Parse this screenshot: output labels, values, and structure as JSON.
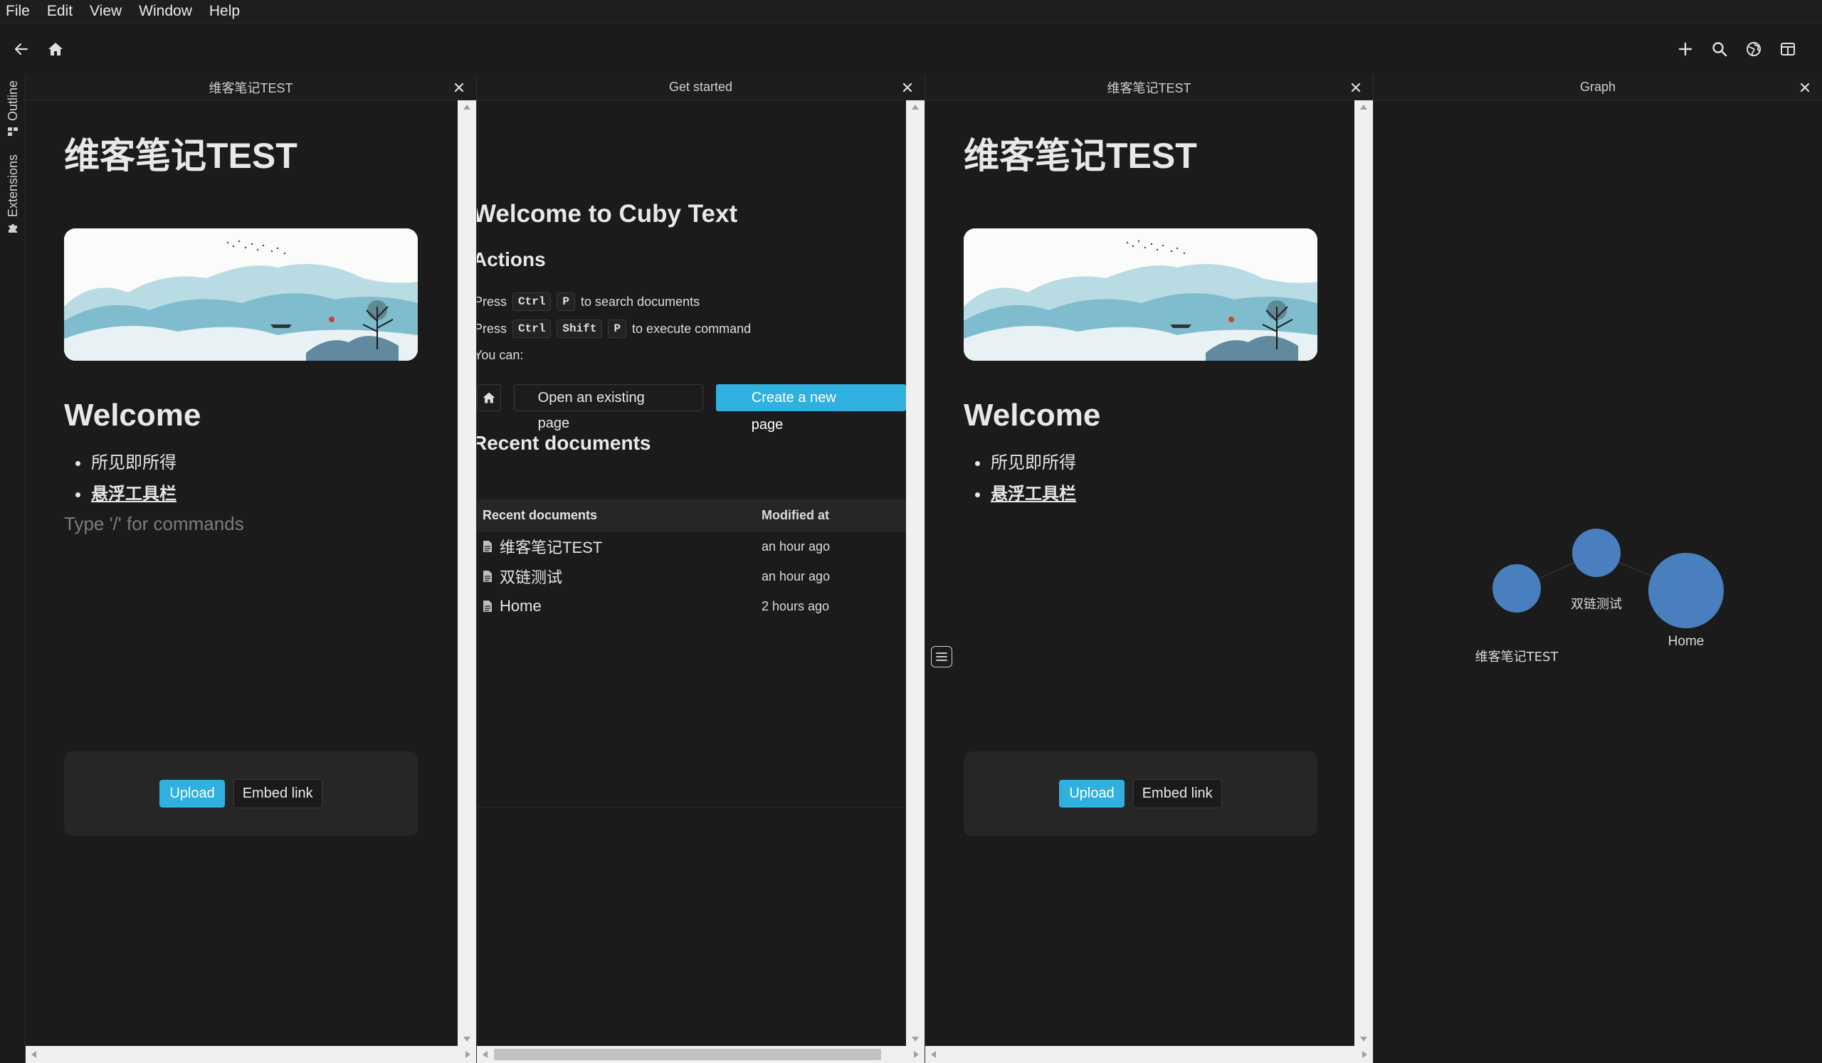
{
  "menu": [
    "File",
    "Edit",
    "View",
    "Window",
    "Help"
  ],
  "toolbar": {
    "left_icons": [
      "back-arrow-icon",
      "home-icon"
    ],
    "right_icons": [
      "plus-icon",
      "search-icon",
      "globe-icon",
      "split-view-icon"
    ]
  },
  "rail": {
    "outline": "Outline",
    "extensions": "Extensions"
  },
  "panes": {
    "left": {
      "tab": "维客笔记TEST",
      "title": "维客笔记TEST",
      "heading": "Welcome",
      "bullets": [
        "所见即所得",
        "悬浮工具栏"
      ],
      "placeholder": "Type '/' for commands",
      "upload": "Upload",
      "embed": "Embed link"
    },
    "middle": {
      "tab": "Get started",
      "title": "Welcome to Cuby Text",
      "actions_heading": "Actions",
      "line1": {
        "prefix": "Press",
        "keys": [
          "Ctrl",
          "P"
        ],
        "suffix": "to search documents"
      },
      "line2": {
        "prefix": "Press",
        "keys": [
          "Ctrl",
          "Shift",
          "P"
        ],
        "suffix": "to execute command"
      },
      "line3": "You can:",
      "open_button": "Open an existing page",
      "create_button": "Create a new page",
      "recent_heading": "Recent documents",
      "table": {
        "columns": [
          "Recent documents",
          "Modified at"
        ],
        "rows": [
          {
            "name": "维客笔记TEST",
            "modified": "an hour ago"
          },
          {
            "name": "双链测试",
            "modified": "an hour ago"
          },
          {
            "name": "Home",
            "modified": "2 hours ago"
          }
        ]
      }
    },
    "right": {
      "tab": "维客笔记TEST",
      "title": "维客笔记TEST",
      "heading": "Welcome",
      "bullets": [
        "所见即所得",
        "悬浮工具栏"
      ],
      "upload": "Upload",
      "embed": "Embed link"
    },
    "graph": {
      "tab": "Graph",
      "nodes": [
        {
          "label": "维客笔记TEST"
        },
        {
          "label": "双链测试"
        },
        {
          "label": "Home"
        }
      ],
      "node_color": "#4a7fbf"
    }
  },
  "colors": {
    "accent": "#2fb0df",
    "background": "#1b1b1b"
  }
}
